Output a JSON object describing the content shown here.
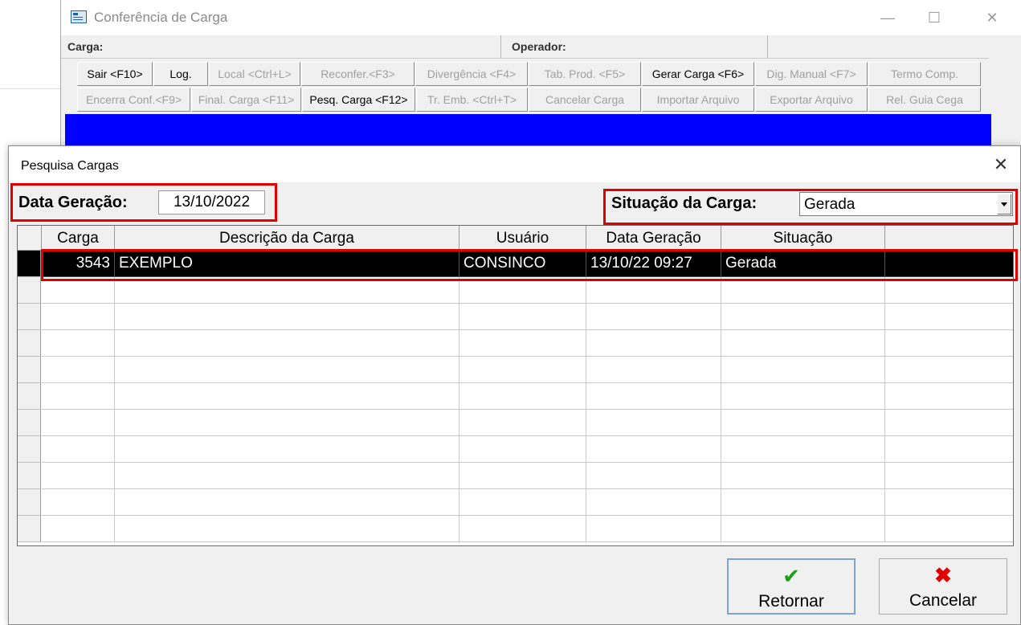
{
  "main_window": {
    "title": "Conferência de Carga",
    "fields": {
      "carga_label": "Carga:",
      "operador_label": "Operador:"
    },
    "toolbar_row1": [
      {
        "label": "Sair <F10>",
        "enabled": true
      },
      {
        "label": "Log.",
        "enabled": true
      },
      {
        "label": "Local <Ctrl+L>",
        "enabled": false
      },
      {
        "label": "Reconfer.<F3>",
        "enabled": false
      },
      {
        "label": "Divergência <F4>",
        "enabled": false
      },
      {
        "label": "Tab. Prod. <F5>",
        "enabled": false
      },
      {
        "label": "Gerar Carga <F6>",
        "enabled": true
      },
      {
        "label": "Dig. Manual <F7>",
        "enabled": false
      },
      {
        "label": "Termo Comp.",
        "enabled": false
      }
    ],
    "toolbar_row2": [
      {
        "label": "Encerra Conf.<F9>",
        "enabled": false
      },
      {
        "label": "Final. Carga <F11>",
        "enabled": false
      },
      {
        "label": "Pesq. Carga <F12>",
        "enabled": true
      },
      {
        "label": "Tr. Emb. <Ctrl+T>",
        "enabled": false
      },
      {
        "label": "Cancelar Carga",
        "enabled": false
      },
      {
        "label": "Importar Arquivo",
        "enabled": false
      },
      {
        "label": "Exportar Arquivo",
        "enabled": false
      },
      {
        "label": "Rel. Guia Cega",
        "enabled": false
      }
    ],
    "window_controls": {
      "minimize": "—",
      "maximize": "☐",
      "close": "✕"
    },
    "colors": {
      "panel_blue": "#0000ff"
    }
  },
  "dialog": {
    "title": "Pesquisa Cargas",
    "close": "✕",
    "data_geracao": {
      "label": "Data Geração:",
      "value": "13/10/2022"
    },
    "situacao": {
      "label": "Situação da Carga:",
      "value": "Gerada"
    },
    "grid": {
      "columns": [
        "Carga",
        "Descrição da Carga",
        "Usuário",
        "Data Geração",
        "Situação",
        ""
      ],
      "rows": [
        {
          "carga": "3543",
          "descricao": "EXEMPLO",
          "usuario": "CONSINCO",
          "data": "13/10/22 09:27",
          "situacao": "Gerada",
          "extra": "",
          "selected": true
        }
      ]
    },
    "buttons": {
      "retornar": {
        "label": "Retornar",
        "icon": "check-icon",
        "color": "#1e9e1e"
      },
      "cancelar": {
        "label": "Cancelar",
        "icon": "x-icon",
        "color": "#e00000"
      }
    },
    "highlight_color": "#e00000"
  }
}
